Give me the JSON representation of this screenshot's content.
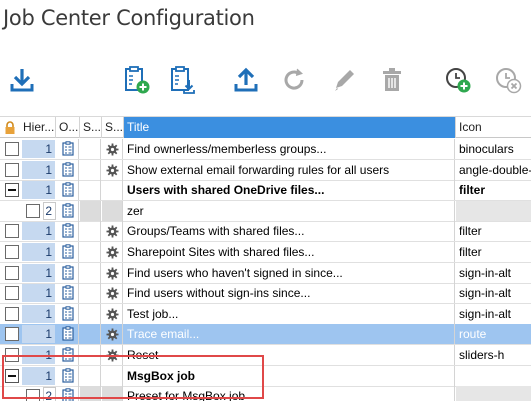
{
  "window": {
    "title": "Job Center Configuration"
  },
  "toolbar": {
    "buttons": [
      {
        "name": "download-icon",
        "color": "#1f6fb8"
      },
      {
        "name": "clipboard-add-icon",
        "color": "#1f6fb8"
      },
      {
        "name": "clipboard-download-icon",
        "color": "#1f6fb8"
      },
      {
        "name": "upload-icon",
        "color": "#1f6fb8"
      },
      {
        "name": "refresh-icon",
        "color": "#a8a8a8"
      },
      {
        "name": "edit-pencil-icon",
        "color": "#a8a8a8"
      },
      {
        "name": "trash-icon",
        "color": "#a8a8a8"
      },
      {
        "name": "schedule-add-icon",
        "color": "#3a3a3a"
      },
      {
        "name": "schedule-remove-icon",
        "color": "#a8a8a8"
      }
    ]
  },
  "grid": {
    "columns": [
      "Hier...",
      "O...",
      "S...",
      "S...",
      "Title",
      "Icon"
    ],
    "rows": [
      {
        "hier": "1",
        "title": "Find ownerless/memberless groups...",
        "icon": "binoculars",
        "level": 0
      },
      {
        "hier": "1",
        "title": "Show external email forwarding rules for all users",
        "icon": "angle-double-",
        "level": 0
      },
      {
        "hier": "1",
        "title": "Users with shared OneDrive files...",
        "icon": "filter",
        "level": 0,
        "bold": true,
        "expanded": true
      },
      {
        "hier": "2",
        "title": "zer",
        "icon": "",
        "level": 1
      },
      {
        "hier": "1",
        "title": "Groups/Teams with shared files...",
        "icon": "filter",
        "level": 0
      },
      {
        "hier": "1",
        "title": "Sharepoint Sites with shared files...",
        "icon": "filter",
        "level": 0
      },
      {
        "hier": "1",
        "title": "Find users who haven't signed in since...",
        "icon": "sign-in-alt",
        "level": 0
      },
      {
        "hier": "1",
        "title": "Find users without sign-ins since...",
        "icon": "sign-in-alt",
        "level": 0
      },
      {
        "hier": "1",
        "title": "Test job...",
        "icon": "sign-in-alt",
        "level": 0
      },
      {
        "hier": "1",
        "title": "Trace email...",
        "icon": "route",
        "level": 0,
        "highlight": true
      },
      {
        "hier": "1",
        "title": "Reset",
        "icon": "sliders-h",
        "level": 0
      },
      {
        "hier": "1",
        "title": "MsgBox job",
        "icon": "",
        "level": 0,
        "bold": true,
        "expanded": true
      },
      {
        "hier": "2",
        "title": "Preset for MsgBox job",
        "icon": "",
        "level": 1
      }
    ]
  }
}
